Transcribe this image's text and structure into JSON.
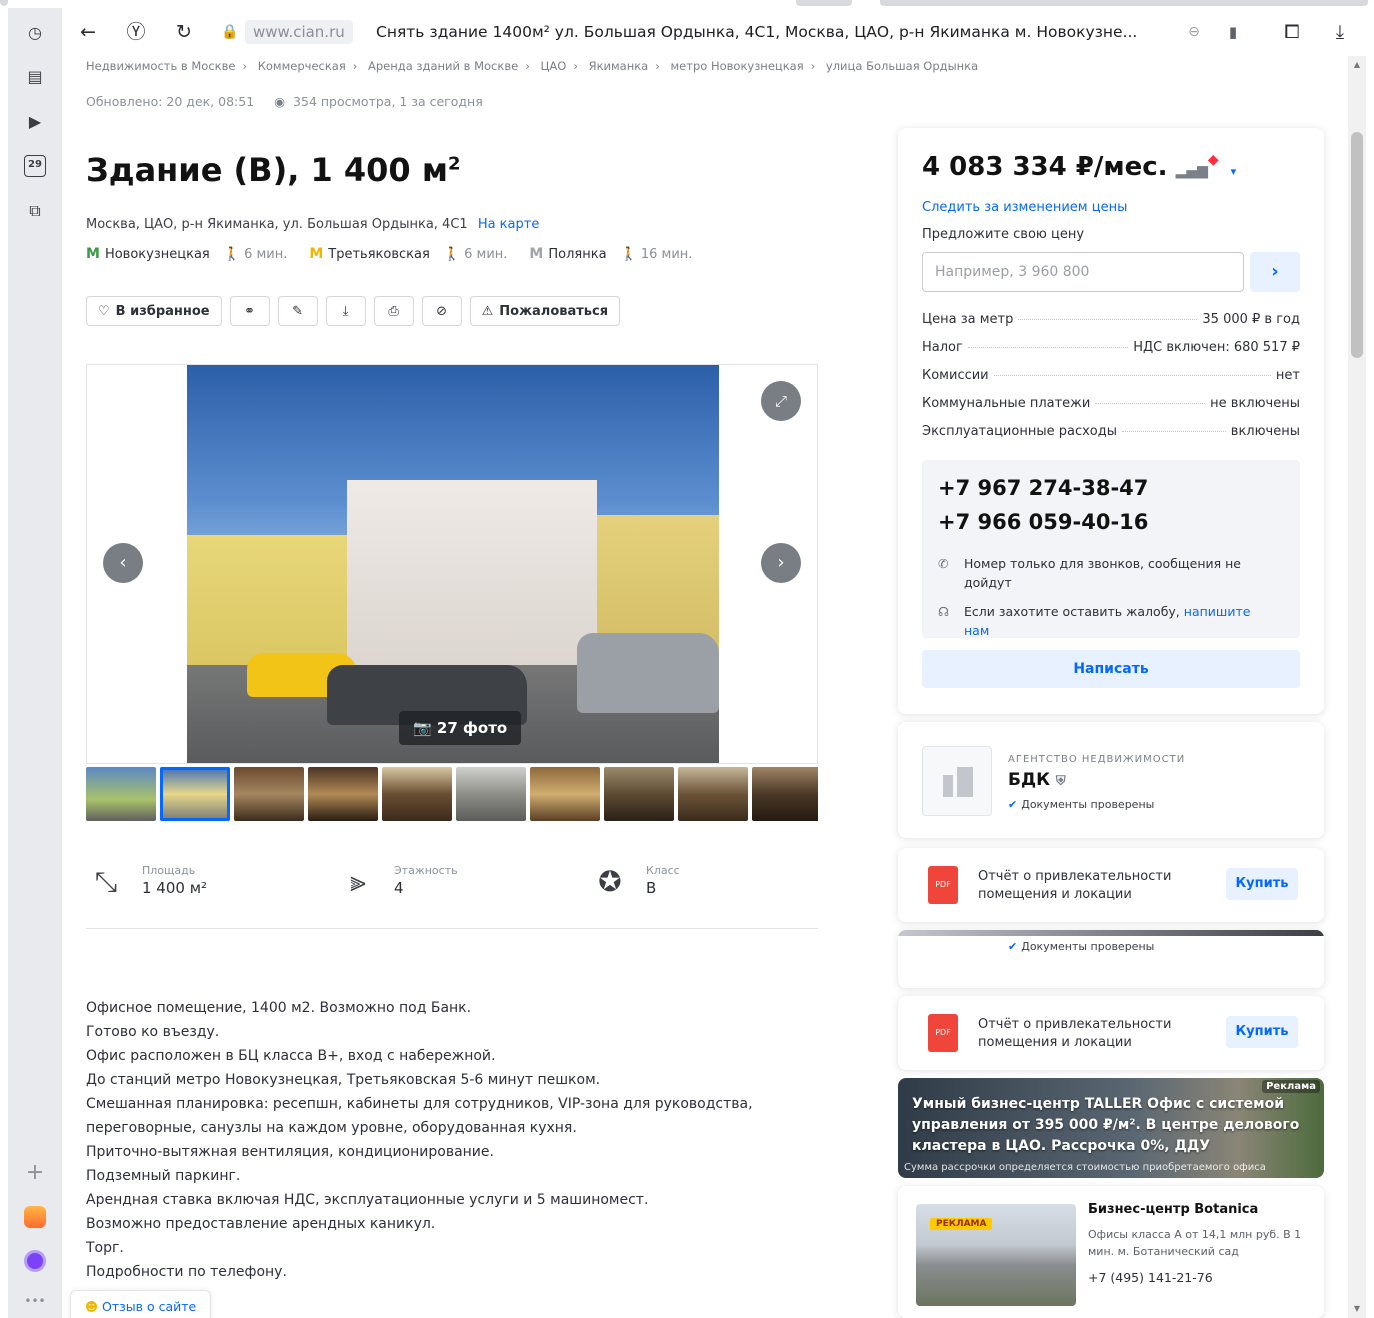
{
  "browser": {
    "domain": "www.cian.ru",
    "tab_title": "Снять здание 1400м² ул. Большая Ордынка, 4С1, Москва, ЦАО, р-н Якиманка м. Новокузне...",
    "sidebar_date": "29"
  },
  "breadcrumbs": [
    "Недвижимость в Москве",
    "Коммерческая",
    "Аренда зданий в Москве",
    "ЦАО",
    "Якиманка",
    "метро Новокузнецкая",
    "улица Большая Ордынка"
  ],
  "meta": {
    "updated": "Обновлено: 20 дек, 08:51",
    "views": "354 просмотра, 1 за сегодня"
  },
  "listing": {
    "title": "Здание (B), 1 400 м",
    "title_sup": "2",
    "address": "Москва, ЦАО, р-н Якиманка, ул. Большая Ордынка, 4С1",
    "map_link": "На карте",
    "metro": [
      {
        "name": "Новокузнецкая",
        "walk": "6 мин.",
        "color": "#4caf50"
      },
      {
        "name": "Третьяковская",
        "walk": "6 мин.",
        "color": "#ffc107"
      },
      {
        "name": "Полянка",
        "walk": "16 мин.",
        "color": "#9e9e9e"
      }
    ]
  },
  "actions": {
    "favorite": "В избранное",
    "complain": "Пожаловаться"
  },
  "gallery": {
    "photo_count": "27 фото"
  },
  "facts": [
    {
      "label": "Площадь",
      "value": "1 400 м²"
    },
    {
      "label": "Этажность",
      "value": "4"
    },
    {
      "label": "Класс",
      "value": "B"
    }
  ],
  "description": [
    "Офисное помещение, 1400 м2. Возможно под Банк.",
    "Готово ко въезду.",
    "Офис расположен в БЦ класса B+, вход с набережной.",
    "До станций метро Новокузнецкая, Третьяковская 5-6 минут пешком.",
    "Смешанная планировка: ресепшн, кабинеты для сотрудников, VIP-зона для руководства,",
    "переговорные, санузлы на каждом уровне, оборудованная кухня.",
    "Приточно-вытяжная вентиляция, кондиционирование.",
    "Подземный паркинг.",
    "Арендная ставка включая НДС, эксплуатационные услуги и 5 машиномест.",
    "Возможно предоставление арендных каникул.",
    "Торг.",
    "Подробности по телефону."
  ],
  "feedback": "Отзыв о сайте",
  "price_card": {
    "price": "4 083 334 ₽/мес.",
    "track": "Следить за изменением цены",
    "offer_label": "Предложите свою цену",
    "offer_placeholder": "Например, 3 960 800",
    "terms": [
      {
        "label": "Цена за метр",
        "value": "35 000 ₽ в год"
      },
      {
        "label": "Налог",
        "value": "НДС включен: 680 517 ₽"
      },
      {
        "label": "Комиссии",
        "value": "нет"
      },
      {
        "label": "Коммунальные платежи",
        "value": "не включены"
      },
      {
        "label": "Эксплуатационные расходы",
        "value": "включены"
      }
    ],
    "phones": [
      "+7 967 274-38-47",
      "+7 966 059-40-16"
    ],
    "phone_note": "Номер только для звонков, сообщения не дойдут",
    "complaint_note": "Если захотите оставить жалобу,",
    "complaint_link": "напишите нам",
    "write": "Написать"
  },
  "agency": {
    "label": "АГЕНТСТВО НЕДВИЖИМОСТИ",
    "name": "БДК",
    "verified": "Документы проверены"
  },
  "report": {
    "text": "Отчёт о привлекательности помещения и локации",
    "buy": "Купить",
    "pdf": "PDF"
  },
  "ad_banner": {
    "tag": "Реклама",
    "text": "Умный бизнес-центр TALLER Офис с системой управления от 395 000 ₽/м². В центре делового кластера в ЦАО. Рассрочка 0%, ДДУ",
    "small": "Сумма рассрочки определяется стоимостью приобретаемого офиса"
  },
  "bc_ad": {
    "tag": "РЕКЛАМА",
    "name": "Бизнес-центр Botanica",
    "desc": "Офисы класса А от 14,1 млн руб. В 1 мин. м. Ботанический сад",
    "tel": "+7 (495) 141-21-76"
  }
}
